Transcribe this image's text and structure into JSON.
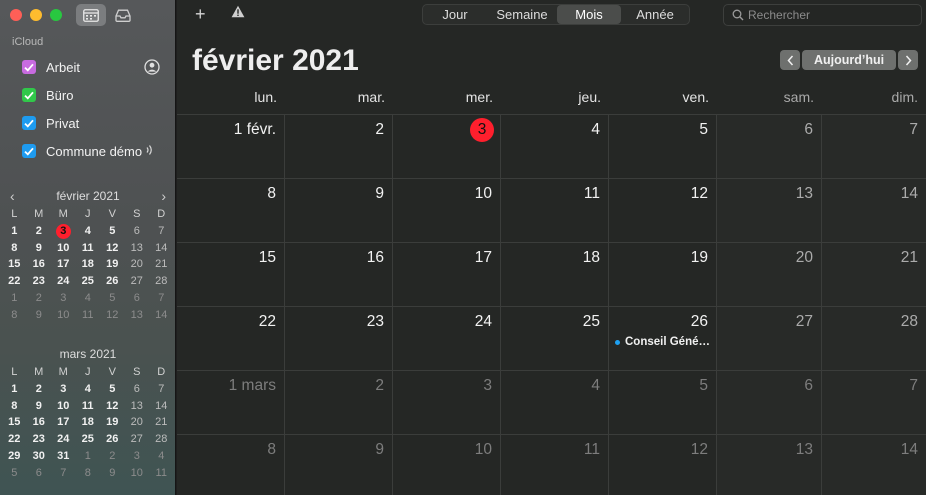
{
  "window": {
    "traffic_lights": {
      "close": "#ff5f57",
      "minimize": "#febc2e",
      "maximize": "#28c840"
    }
  },
  "sidebar": {
    "account_label": "iCloud",
    "calendars": [
      {
        "label": "Arbeit",
        "color": "#c86be0",
        "checked": true,
        "trail_icon": "person-circle-icon"
      },
      {
        "label": "Büro",
        "color": "#31c84a",
        "checked": true,
        "trail_icon": ""
      },
      {
        "label": "Privat",
        "color": "#1e9bf0",
        "checked": true,
        "trail_icon": ""
      },
      {
        "label": "Commune démo",
        "color": "#1e9bf0",
        "checked": true,
        "trail_icon": "broadcast-icon"
      }
    ],
    "mini_months": [
      {
        "title": "février 2021",
        "dow": [
          "L",
          "M",
          "M",
          "J",
          "V",
          "S",
          "D"
        ],
        "weeks": [
          [
            "1",
            "2",
            "3",
            "4",
            "5",
            "6",
            "7"
          ],
          [
            "8",
            "9",
            "10",
            "11",
            "12",
            "13",
            "14"
          ],
          [
            "15",
            "16",
            "17",
            "18",
            "19",
            "20",
            "21"
          ],
          [
            "22",
            "23",
            "24",
            "25",
            "26",
            "27",
            "28"
          ],
          [
            "1",
            "2",
            "3",
            "4",
            "5",
            "6",
            "7"
          ],
          [
            "8",
            "9",
            "10",
            "11",
            "12",
            "13",
            "14"
          ]
        ],
        "other_month_from_week": 4,
        "today": "3"
      },
      {
        "title": "mars 2021",
        "dow": [
          "L",
          "M",
          "M",
          "J",
          "V",
          "S",
          "D"
        ],
        "weeks": [
          [
            "1",
            "2",
            "3",
            "4",
            "5",
            "6",
            "7"
          ],
          [
            "8",
            "9",
            "10",
            "11",
            "12",
            "13",
            "14"
          ],
          [
            "15",
            "16",
            "17",
            "18",
            "19",
            "20",
            "21"
          ],
          [
            "22",
            "23",
            "24",
            "25",
            "26",
            "27",
            "28"
          ],
          [
            "29",
            "30",
            "31",
            "1",
            "2",
            "3",
            "4"
          ],
          [
            "5",
            "6",
            "7",
            "8",
            "9",
            "10",
            "11"
          ]
        ],
        "other_month_start": [
          4,
          3
        ],
        "today": ""
      }
    ]
  },
  "toolbar": {
    "add_label": "+",
    "views": [
      {
        "label": "Jour",
        "active": false
      },
      {
        "label": "Semaine",
        "active": false
      },
      {
        "label": "Mois",
        "active": true
      },
      {
        "label": "Année",
        "active": false
      }
    ],
    "search_placeholder": "Rechercher"
  },
  "header": {
    "month_title": "février 2021",
    "today_label": "Aujourd’hui"
  },
  "weekday_headers": [
    "lun.",
    "mar.",
    "mer.",
    "jeu.",
    "ven.",
    "sam.",
    "dim."
  ],
  "month_grid": {
    "weeks": [
      [
        "1 févr.",
        "2",
        "3",
        "4",
        "5",
        "6",
        "7"
      ],
      [
        "8",
        "9",
        "10",
        "11",
        "12",
        "13",
        "14"
      ],
      [
        "15",
        "16",
        "17",
        "18",
        "19",
        "20",
        "21"
      ],
      [
        "22",
        "23",
        "24",
        "25",
        "26",
        "27",
        "28"
      ],
      [
        "1 mars",
        "2",
        "3",
        "4",
        "5",
        "6",
        "7"
      ],
      [
        "8",
        "9",
        "10",
        "11",
        "12",
        "13",
        "14"
      ]
    ],
    "other_month_from_week": 4,
    "today": {
      "week": 0,
      "day": 2
    },
    "events": [
      {
        "week": 3,
        "day": 4,
        "title": "Conseil Géné…",
        "color": "#1ea1f2"
      }
    ]
  }
}
